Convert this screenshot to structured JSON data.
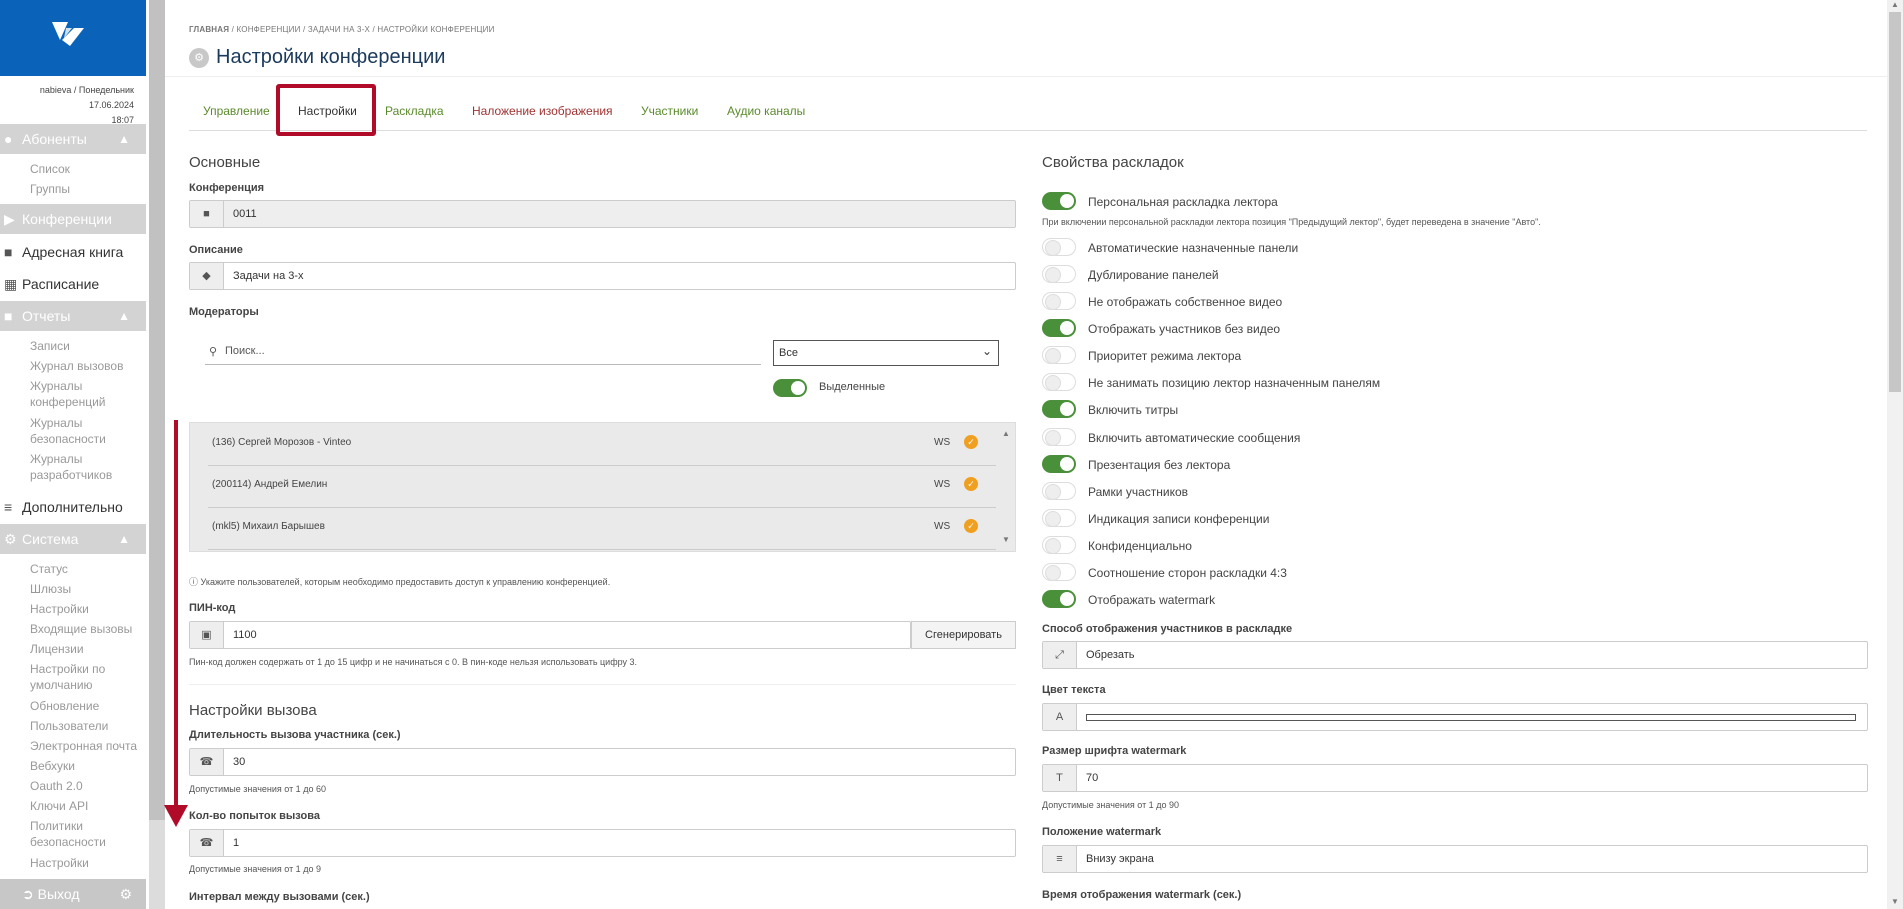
{
  "sidebar": {
    "user_line1": "nabieva / Понедельник 17.06.2024",
    "user_line2": "18:07",
    "sections": {
      "subscribers": "Абоненты",
      "conferences": "Конференции",
      "addressbook": "Адресная книга",
      "schedule": "Расписание",
      "reports": "Отчеты",
      "extra": "Дополнительно",
      "system": "Система"
    },
    "subscribers_items": [
      "Список",
      "Группы"
    ],
    "reports_items": [
      "Записи",
      "Журнал вызовов",
      "Журналы",
      "конференций",
      "Журналы",
      "безопасности",
      "Журналы",
      "разработчиков"
    ],
    "system_items": [
      "Статус",
      "Шлюзы",
      "Настройки",
      "Входящие вызовы",
      "Лицензии",
      "Настройки по",
      "умолчанию",
      "Обновление",
      "Пользователи",
      "Электронная почта",
      "Вебхуки",
      "Oauth 2.0",
      "Ключи API",
      "Политики",
      "безопасности",
      "Настройки"
    ],
    "logout": "Выход"
  },
  "breadcrumbs": {
    "b1": "ГЛАВНАЯ",
    "b2": "/ КОНФЕРЕНЦИИ",
    "b3": "/ ЗАДАЧИ НА 3-Х",
    "b4": "/ НАСТРОЙКИ КОНФЕРЕНЦИИ"
  },
  "page_title": "Настройки конференции",
  "tabs": [
    "Управление",
    "Настройки",
    "Раскладка",
    "Наложение изображения",
    "Участники",
    "Аудио каналы"
  ],
  "left": {
    "basic_title": "Основные",
    "conference_label": "Конференция",
    "conference_value": "0011",
    "description_label": "Описание",
    "description_value": "Задачи на 3-х",
    "moderators_label": "Модераторы",
    "search_placeholder": "Поиск...",
    "filter_value": "Все",
    "selected_label": "Выделенные",
    "moderators": [
      {
        "name": "(136) Сергей Морозов - Vinteo",
        "type": "WS"
      },
      {
        "name": "(200114) Андрей Емелин",
        "type": "WS"
      },
      {
        "name": "(mkl5) Михаил Барышев",
        "type": "WS"
      }
    ],
    "moderators_hint": "Укажите пользователей, которым необходимо предоставить доступ к управлению конференцией.",
    "pin_label": "ПИН-код",
    "pin_value": "1100",
    "generate_button": "Сгенерировать",
    "pin_hint": "Пин-код должен содержать от 1 до 15 цифр и не начинаться с 0. В пин-коде нельзя использовать цифру 3.",
    "call_settings_title": "Настройки вызова",
    "call_duration_label": "Длительность вызова участника (сек.)",
    "call_duration_value": "30",
    "call_duration_hint": "Допустимые значения от 1 до 60",
    "attempts_label": "Кол-во попыток вызова",
    "attempts_value": "1",
    "attempts_hint": "Допустимые значения от 1 до 9",
    "interval_label": "Интервал между вызовами (сек.)"
  },
  "right": {
    "layout_props_title": "Свойства раскладок",
    "toggles": [
      {
        "label": "Персональная раскладка лектора",
        "on": true
      },
      {
        "label": "Автоматические назначенные панели",
        "on": false
      },
      {
        "label": "Дублирование панелей",
        "on": false
      },
      {
        "label": "Не отображать собственное видео",
        "on": false
      },
      {
        "label": "Отображать участников без видео",
        "on": true
      },
      {
        "label": "Приоритет режима лектора",
        "on": false
      },
      {
        "label": "Не занимать позицию лектор назначенным панелям",
        "on": false
      },
      {
        "label": "Включить титры",
        "on": true
      },
      {
        "label": "Включить автоматические сообщения",
        "on": false
      },
      {
        "label": "Презентация без лектора",
        "on": true
      },
      {
        "label": "Рамки участников",
        "on": false
      },
      {
        "label": "Индикация записи конференции",
        "on": false
      },
      {
        "label": "Конфиденциально",
        "on": false
      },
      {
        "label": "Соотношение сторон раскладки 4:3",
        "on": false
      },
      {
        "label": "Отображать watermark",
        "on": true
      }
    ],
    "personal_hint": "При включении персональной раскладки лектора позиция \"Предыдущий лектор\", будет переведена в значение \"Авто\".",
    "display_mode_label": "Способ отображения участников в раскладке",
    "display_mode_value": "Обрезать",
    "text_color_label": "Цвет текста",
    "wm_font_label": "Размер шрифта watermark",
    "wm_font_value": "70",
    "wm_font_hint": "Допустимые значения от 1 до 90",
    "wm_position_label": "Положение watermark",
    "wm_position_value": "Внизу экрана",
    "wm_time_label": "Время отображения watermark (сек.)"
  },
  "colors": {
    "brand": "#0a63b8",
    "active_toggle": "#4a8f3a",
    "highlight": "#b00c2a"
  }
}
